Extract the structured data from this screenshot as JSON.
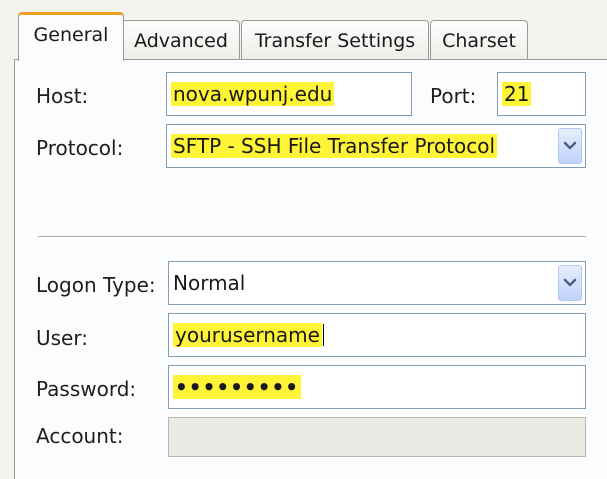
{
  "tabs": [
    {
      "label": "General",
      "active": true
    },
    {
      "label": "Advanced",
      "active": false
    },
    {
      "label": "Transfer Settings",
      "active": false
    },
    {
      "label": "Charset",
      "active": false
    }
  ],
  "form": {
    "host_label": "Host:",
    "host_value": "nova.wpunj.edu",
    "port_label": "Port:",
    "port_value": "21",
    "protocol_label": "Protocol:",
    "protocol_value": "SFTP - SSH File Transfer Protocol",
    "logon_type_label": "Logon Type:",
    "logon_type_value": "Normal",
    "user_label": "User:",
    "user_value": "yourusername",
    "password_label": "Password:",
    "password_value": "•••••••••",
    "account_label": "Account:",
    "account_value": ""
  },
  "colors": {
    "highlight": "#fff436",
    "active_tab_accent": "#f0a020",
    "field_border": "#7f9db9",
    "dropdown_arrow": "#4d6185"
  },
  "icons": {
    "dropdown": "chevron-down-icon"
  }
}
